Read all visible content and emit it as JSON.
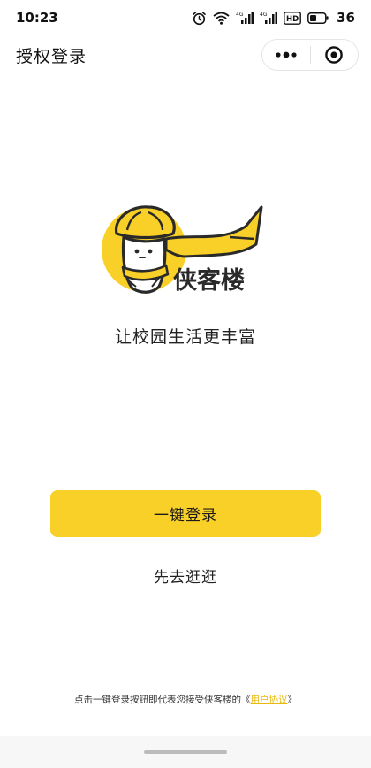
{
  "status_bar": {
    "time": "10:23",
    "battery_level": "36",
    "network_labels": [
      "4G",
      "4G",
      "HD"
    ],
    "icons": [
      "alarm-icon",
      "wifi-icon",
      "signal-4g-icon",
      "signal-4g-icon",
      "hd-icon",
      "battery-icon"
    ]
  },
  "nav": {
    "title": "授权登录",
    "more_icon": "more-dots-icon",
    "close_icon": "target-circle-icon"
  },
  "logo": {
    "text": "侠客楼",
    "colors": {
      "yellow": "#f8d027",
      "dark": "#2a2a2a"
    }
  },
  "main": {
    "slogan": "让校园生活更丰富",
    "login_button": "一键登录",
    "browse_link": "先去逛逛"
  },
  "agreement": {
    "prefix": "点击一键登录按钮即代表您接受侠客楼的《",
    "link": "用户协议",
    "suffix": "》"
  },
  "colors": {
    "accent": "#f8d027",
    "link": "#e8b90f",
    "text": "#222222"
  }
}
